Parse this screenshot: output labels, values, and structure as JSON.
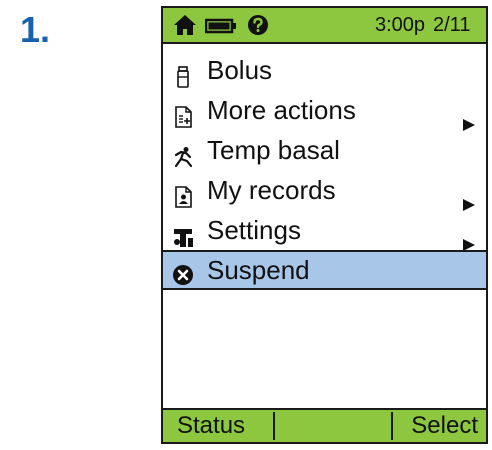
{
  "step": {
    "number": "1."
  },
  "status_bar": {
    "time": "3:00p",
    "page": "2/11",
    "icons": [
      "home-icon",
      "battery-icon",
      "help-icon"
    ]
  },
  "menu": {
    "items": [
      {
        "label": "Bolus",
        "icon": "vial-icon",
        "has_submenu": false,
        "selected": false
      },
      {
        "label": "More actions",
        "icon": "document-icon",
        "has_submenu": true,
        "selected": false
      },
      {
        "label": "Temp basal",
        "icon": "runner-icon",
        "has_submenu": false,
        "selected": false
      },
      {
        "label": "My records",
        "icon": "records-icon",
        "has_submenu": true,
        "selected": false
      },
      {
        "label": "Settings",
        "icon": "settings-icon",
        "has_submenu": true,
        "selected": false
      },
      {
        "label": "Suspend",
        "icon": "suspend-icon",
        "has_submenu": false,
        "selected": true
      }
    ]
  },
  "softkeys": {
    "left": "Status",
    "right": "Select"
  },
  "colors": {
    "bar_green": "#8dc63f",
    "selection_blue": "#a8c6e8",
    "step_blue": "#1761ad"
  }
}
